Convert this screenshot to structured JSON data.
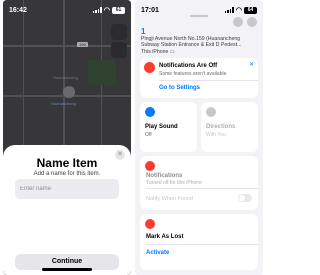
{
  "left_screen": {
    "status": {
      "time": "16:42",
      "battery": "61"
    },
    "map": {
      "route_number": "196",
      "place_labels": [
        "Huanancheng",
        "Huanancheng"
      ]
    },
    "name_item": {
      "title": "Name Item",
      "subtitle": "Add a name for this item.",
      "placeholder": "Enter name",
      "close_icon": "close-icon",
      "continue_label": "Continue"
    }
  },
  "right_screen": {
    "status": {
      "time": "17:01",
      "battery": "64"
    },
    "location": {
      "number": "1",
      "address": "Pingji Avenue North No.159 (Huanancheng Subway Station Entrance & Exit D Pedest...",
      "device": "This iPhone"
    },
    "notifications_banner": {
      "title": "Notifications Are Off",
      "subtitle": "Some features aren't available",
      "link": "Go to Settings"
    },
    "actions": {
      "play_sound": {
        "title": "Play Sound",
        "subtitle": "Off"
      },
      "directions": {
        "title": "Directions",
        "subtitle": "With You"
      }
    },
    "notifications_card": {
      "title": "Notifications",
      "subtitle": "Turned off for this iPhone",
      "notify_label": "Notify When Found"
    },
    "lost_mode": {
      "title": "Mark As Lost",
      "action": "Activate"
    }
  },
  "colors": {
    "accent": "#007aff",
    "alert": "#ff3b30",
    "sheet_bg": "#ffffff",
    "panel_bg": "#f2f2f7"
  }
}
